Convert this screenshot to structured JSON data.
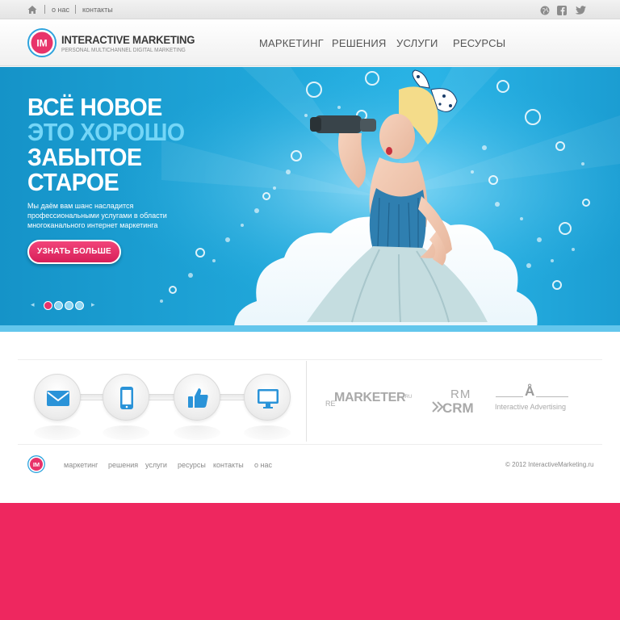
{
  "topbar": {
    "links": [
      "о нас",
      "контакты"
    ],
    "social_icons": [
      "globe-icon",
      "facebook-icon",
      "twitter-icon"
    ]
  },
  "header": {
    "logo_mark": "IM",
    "logo_title": "INTERACTIVE MARKETING",
    "logo_subtitle": "PERSONAL MULTICHANNEL DIGITAL MARKETING",
    "nav": [
      "МАРКЕТИНГ",
      "РЕШЕНИЯ",
      "УСЛУГИ",
      "РЕСУРСЫ"
    ]
  },
  "hero": {
    "headline": [
      "ВСЁ НОВОЕ",
      "ЭТО ХОРОШО",
      "ЗАБЫТОЕ",
      "СТАРОЕ"
    ],
    "text": "Мы даём вам шанс насладится профессиональными услугами в области многоканального интернет маркетинга",
    "cta_label": "УЗНАТЬ БОЛЬШЕ",
    "slider": {
      "slides": 4,
      "active": 1
    }
  },
  "features": {
    "icons": [
      "mail-icon",
      "phone-icon",
      "thumbs-up-icon",
      "monitor-icon"
    ],
    "partners": {
      "remarketer": {
        "prefix": "RE",
        "name": "MARKETER",
        "suffix": ".RU"
      },
      "rmcrm": {
        "top": "RM",
        "bottom": "CRM"
      },
      "ia": {
        "letter": "Å",
        "caption": "Interactive Advertising"
      }
    }
  },
  "footer": {
    "logo_mark": "IM",
    "links": [
      "маркетинг",
      "решения",
      "услуги",
      "ресурсы",
      "контакты",
      "о нас"
    ],
    "copyright": "© 2012 InteractiveMarketing.ru"
  },
  "colors": {
    "brand_pink": "#ee275f",
    "hero_blue": "#1fa5d8",
    "accent_blue": "#74d6f7"
  }
}
